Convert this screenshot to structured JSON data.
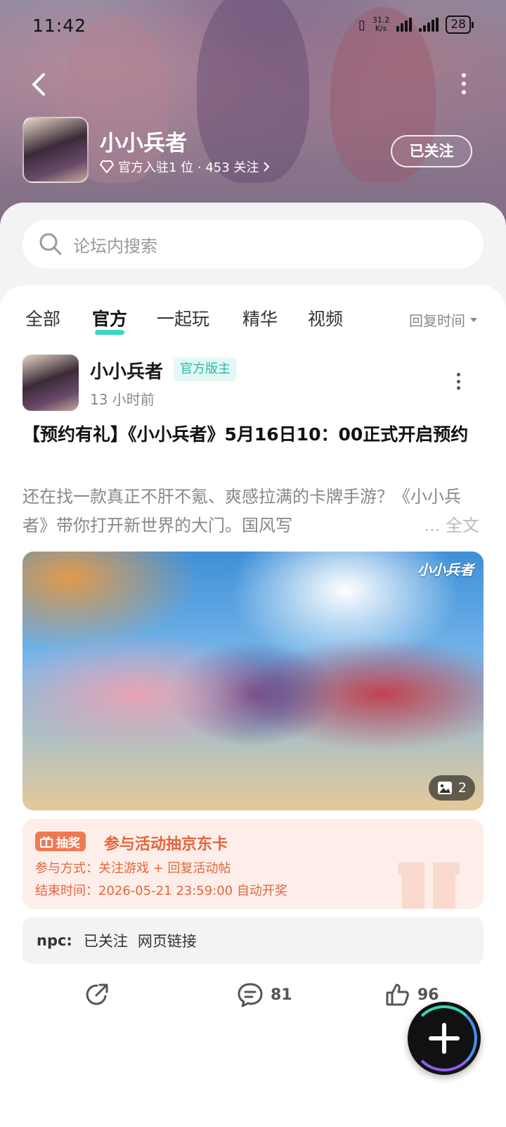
{
  "status_bar": {
    "time": "11:42",
    "net_speed_value": "31.2",
    "net_speed_unit": "K/s",
    "battery": "28"
  },
  "header": {
    "forum_name": "小小兵者",
    "meta": "官方入驻1 位 · 453 关注",
    "follow_label": "已关注"
  },
  "search": {
    "placeholder": "论坛内搜索"
  },
  "tabs": {
    "items": [
      "全部",
      "官方",
      "一起玩",
      "精华",
      "视频"
    ],
    "active": "官方",
    "sort_label": "回复时间"
  },
  "post": {
    "author": "小小兵者",
    "badge": "官方版主",
    "time": "13 小时前",
    "title": "【预约有礼】《小小兵者》5月16日10：00正式开启预约",
    "excerpt": "还在找一款真正不肝不氪、爽感拉满的卡牌手游？《小小兵者》带你打开新世界的大门。国风写",
    "read_more": "... 全文",
    "image_logo": "小小兵者",
    "image_count": "2",
    "lottery": {
      "badge": "抽奖",
      "title": "参与活动抽京东卡",
      "method": "参与方式：关注游戏 + 回复活动帖",
      "end_time": "结束时间：2026-05-21 23:59:00 自动开奖",
      "accent": "#e4663e"
    },
    "npc": {
      "label": "npc:",
      "items": [
        "已关注",
        "网页链接"
      ]
    },
    "actions": {
      "comments": "81",
      "likes": "96"
    }
  },
  "colors": {
    "accent_teal": "#3cd6c4",
    "badge_teal": "#28b8a6"
  }
}
